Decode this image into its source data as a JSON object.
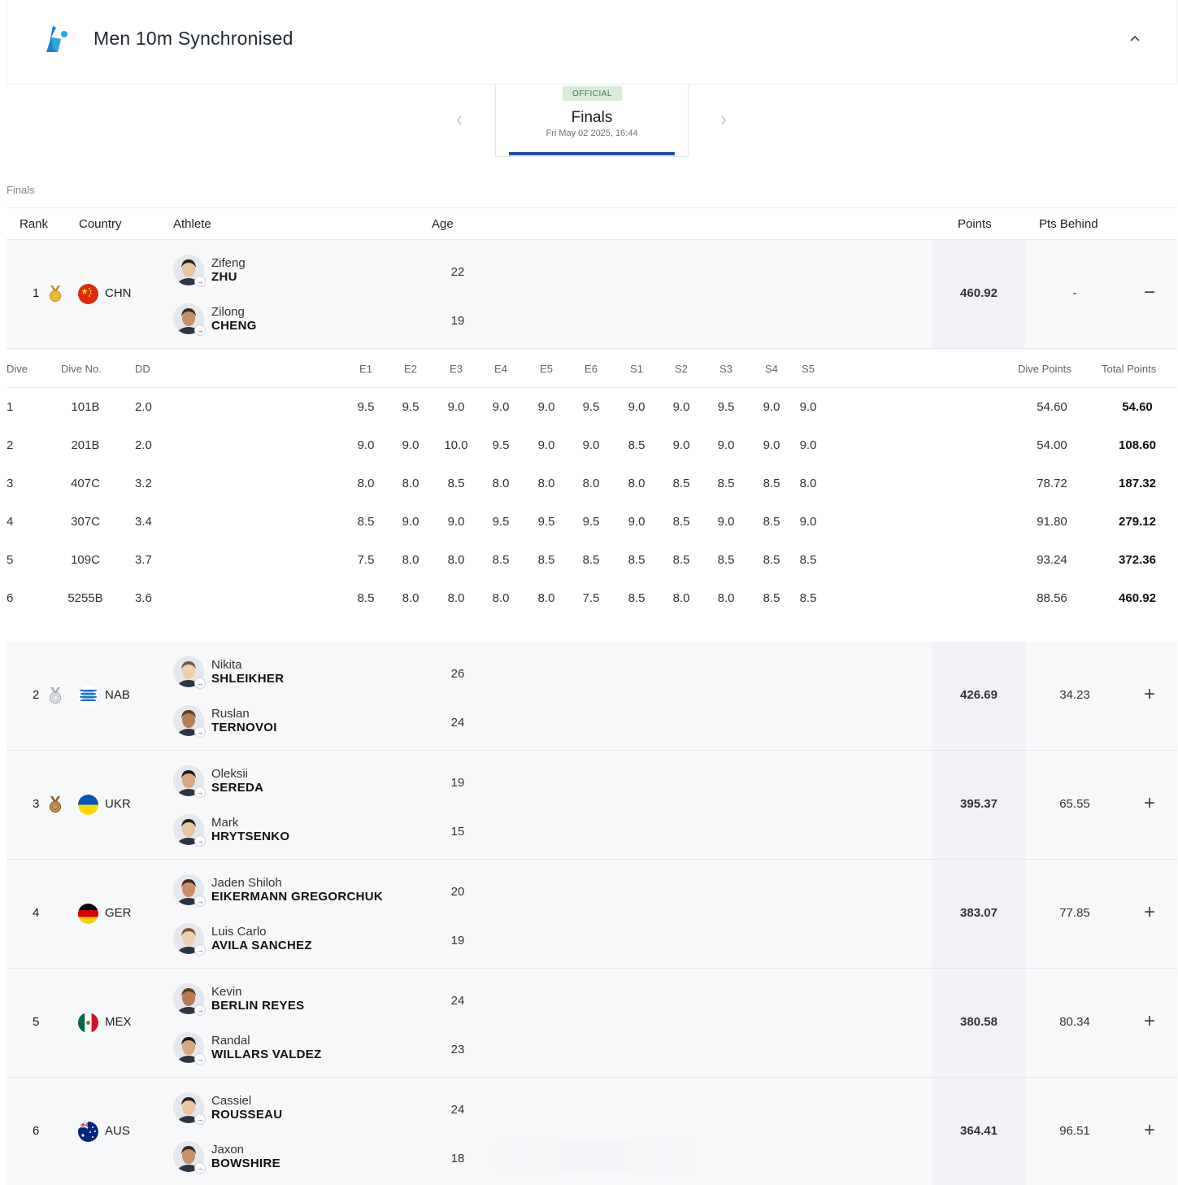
{
  "event": {
    "title": "Men 10m Synchronised",
    "collapse_icon": "chevron-up-icon"
  },
  "phase": {
    "badge": "OFFICIAL",
    "name": "Finals",
    "date": "Fri May 02 2025, 16:44"
  },
  "section_label": "Finals",
  "columns": {
    "rank": "Rank",
    "country": "Country",
    "athlete": "Athlete",
    "age": "Age",
    "points": "Points",
    "behind": "Pts Behind"
  },
  "dive_columns": {
    "dive": "Dive",
    "dive_no": "Dive No.",
    "dd": "DD",
    "e1": "E1",
    "e2": "E2",
    "e3": "E3",
    "e4": "E4",
    "e5": "E5",
    "e6": "E6",
    "s1": "S1",
    "s2": "S2",
    "s3": "S3",
    "s4": "S4",
    "s5": "S5",
    "dive_points": "Dive Points",
    "total_points": "Total Points"
  },
  "teams": [
    {
      "rank": "1",
      "medal": "gold",
      "country": "CHN",
      "points": "460.92",
      "behind": "-",
      "toggle": "−",
      "athletes": [
        {
          "first": "Zifeng",
          "last": "ZHU",
          "age": "22"
        },
        {
          "first": "Zilong",
          "last": "CHENG",
          "age": "19"
        }
      ]
    },
    {
      "rank": "2",
      "medal": "silver",
      "country": "NAB",
      "points": "426.69",
      "behind": "34.23",
      "toggle": "+",
      "athletes": [
        {
          "first": "Nikita",
          "last": "SHLEIKHER",
          "age": "26"
        },
        {
          "first": "Ruslan",
          "last": "TERNOVOI",
          "age": "24"
        }
      ]
    },
    {
      "rank": "3",
      "medal": "bronze",
      "country": "UKR",
      "points": "395.37",
      "behind": "65.55",
      "toggle": "+",
      "athletes": [
        {
          "first": "Oleksii",
          "last": "SEREDA",
          "age": "19"
        },
        {
          "first": "Mark",
          "last": "HRYTSENKO",
          "age": "15"
        }
      ]
    },
    {
      "rank": "4",
      "medal": "",
      "country": "GER",
      "points": "383.07",
      "behind": "77.85",
      "toggle": "+",
      "athletes": [
        {
          "first": "Jaden Shiloh",
          "last": "EIKERMANN GREGORCHUK",
          "age": "20"
        },
        {
          "first": "Luis Carlo",
          "last": "AVILA SANCHEZ",
          "age": "19"
        }
      ]
    },
    {
      "rank": "5",
      "medal": "",
      "country": "MEX",
      "points": "380.58",
      "behind": "80.34",
      "toggle": "+",
      "athletes": [
        {
          "first": "Kevin",
          "last": "BERLIN REYES",
          "age": "24"
        },
        {
          "first": "Randal",
          "last": "WILLARS VALDEZ",
          "age": "23"
        }
      ]
    },
    {
      "rank": "6",
      "medal": "",
      "country": "AUS",
      "points": "364.41",
      "behind": "96.51",
      "toggle": "+",
      "athletes": [
        {
          "first": "Cassiel",
          "last": "ROUSSEAU",
          "age": "24"
        },
        {
          "first": "Jaxon",
          "last": "BOWSHIRE",
          "age": "18"
        }
      ]
    }
  ],
  "dives": [
    {
      "dive": "1",
      "no": "101B",
      "dd": "2.0",
      "scores": [
        "9.5",
        "9.5",
        "9.0",
        "9.0",
        "9.0",
        "9.5",
        "9.0",
        "9.0",
        "9.5",
        "9.0",
        "9.0"
      ],
      "dive_points": "54.60",
      "total": "54.60"
    },
    {
      "dive": "2",
      "no": "201B",
      "dd": "2.0",
      "scores": [
        "9.0",
        "9.0",
        "10.0",
        "9.5",
        "9.0",
        "9.0",
        "8.5",
        "9.0",
        "9.0",
        "9.0",
        "9.0"
      ],
      "dive_points": "54.00",
      "total": "108.60"
    },
    {
      "dive": "3",
      "no": "407C",
      "dd": "3.2",
      "scores": [
        "8.0",
        "8.0",
        "8.5",
        "8.0",
        "8.0",
        "8.0",
        "8.0",
        "8.5",
        "8.5",
        "8.5",
        "8.0"
      ],
      "dive_points": "78.72",
      "total": "187.32"
    },
    {
      "dive": "4",
      "no": "307C",
      "dd": "3.4",
      "scores": [
        "8.5",
        "9.0",
        "9.0",
        "9.5",
        "9.5",
        "9.5",
        "9.0",
        "8.5",
        "9.0",
        "8.5",
        "9.0"
      ],
      "dive_points": "91.80",
      "total": "279.12"
    },
    {
      "dive": "5",
      "no": "109C",
      "dd": "3.7",
      "scores": [
        "7.5",
        "8.0",
        "8.0",
        "8.5",
        "8.5",
        "8.5",
        "8.5",
        "8.5",
        "8.5",
        "8.5",
        "8.5"
      ],
      "dive_points": "93.24",
      "total": "372.36"
    },
    {
      "dive": "6",
      "no": "5255B",
      "dd": "3.6",
      "scores": [
        "8.5",
        "8.0",
        "8.0",
        "8.0",
        "8.0",
        "7.5",
        "8.5",
        "8.0",
        "8.0",
        "8.5",
        "8.5"
      ],
      "dive_points": "88.56",
      "total": "460.92"
    }
  ]
}
